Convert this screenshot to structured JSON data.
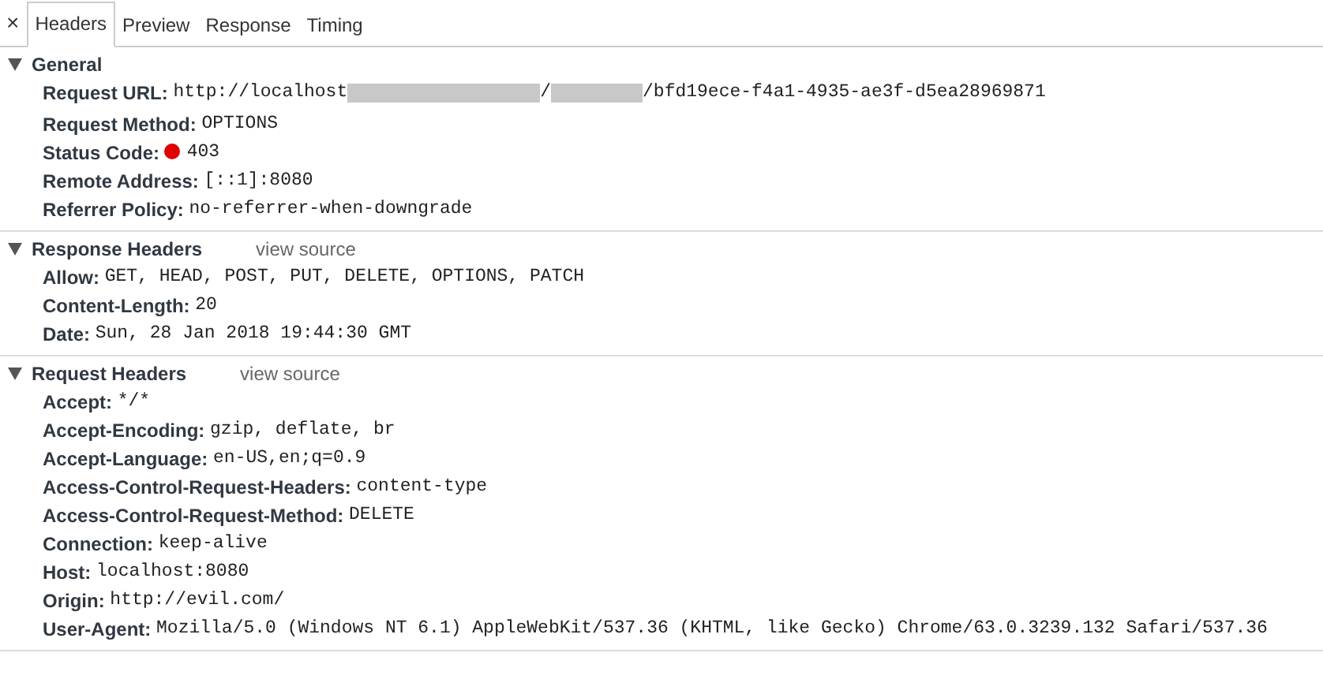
{
  "close_button": "×",
  "tabs": [
    {
      "label": "Headers",
      "selected": true
    },
    {
      "label": "Preview",
      "selected": false
    },
    {
      "label": "Response",
      "selected": false
    },
    {
      "label": "Timing",
      "selected": false
    }
  ],
  "sections": [
    {
      "title": "General",
      "expanded": true,
      "rows": [
        {
          "name": "Request URL:",
          "value_parts": [
            {
              "kind": "text",
              "text": "http://localhost"
            },
            {
              "kind": "redacted"
            },
            {
              "kind": "text",
              "text": "/"
            },
            {
              "kind": "redacted"
            },
            {
              "kind": "text",
              "text": "/bfd19ece-f4a1-4935-ae3f-d5ea28969871"
            }
          ]
        },
        {
          "name": "Request Method:",
          "value": "OPTIONS"
        },
        {
          "name": "Status Code:",
          "value": "403",
          "color": "#e00000"
        },
        {
          "name": "Remote Address:",
          "value": "[::1]:8080"
        },
        {
          "name": "Referrer Policy:",
          "value": "no-referrer-when-downgrade"
        }
      ]
    },
    {
      "title": "Response Headers",
      "link": "view source",
      "expanded": true,
      "rows": [
        {
          "name": "Allow:",
          "value": "GET, HEAD, POST, PUT, DELETE, OPTIONS, PATCH"
        },
        {
          "name": "Content-Length:",
          "value": "20"
        },
        {
          "name": "Date:",
          "value": "Sun, 28 Jan 2018 19:44:30 GMT"
        }
      ]
    },
    {
      "title": "Request Headers",
      "link": "view source",
      "expanded": true,
      "rows": [
        {
          "name": "Accept:",
          "value": "*/*"
        },
        {
          "name": "Accept-Encoding:",
          "value": "gzip, deflate, br"
        },
        {
          "name": "Accept-Language:",
          "value": "en-US,en;q=0.9"
        },
        {
          "name": "Access-Control-Request-Headers:",
          "value": "content-type"
        },
        {
          "name": "Access-Control-Request-Method:",
          "value": "DELETE"
        },
        {
          "name": "Connection:",
          "value": "keep-alive"
        },
        {
          "name": "Host:",
          "value": "localhost:8080"
        },
        {
          "name": "Origin:",
          "value": "http://evil.com/"
        },
        {
          "name": "User-Agent:",
          "value": "Mozilla/5.0 (Windows NT 6.1) AppleWebKit/537.36 (KHTML, like Gecko) Chrome/63.0.3239.132 Safari/537.36"
        }
      ]
    }
  ]
}
